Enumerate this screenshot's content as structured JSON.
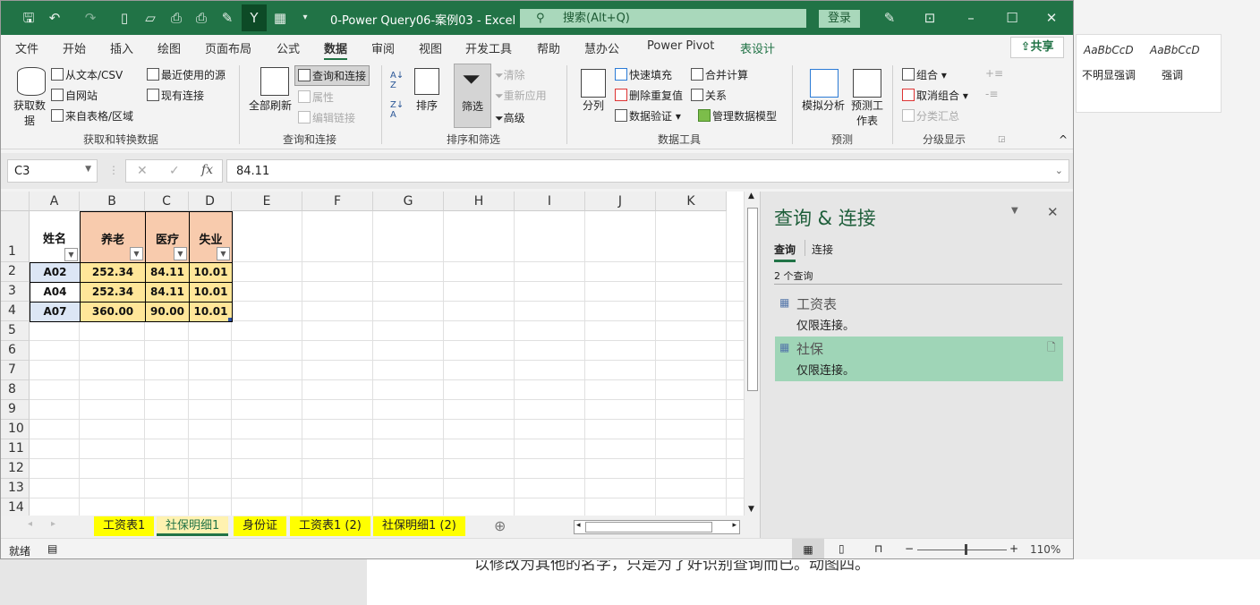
{
  "window": {
    "title": "0-Power Query06-案例03  -  Excel",
    "search_placeholder": "搜索(Alt+Q)",
    "login": "登录"
  },
  "menu_tabs": [
    "文件",
    "开始",
    "插入",
    "绘图",
    "页面布局",
    "公式",
    "数据",
    "审阅",
    "视图",
    "开发工具",
    "帮助",
    "慧办公",
    "Power Pivot",
    "表设计"
  ],
  "active_tab": "数据",
  "share": "共享",
  "ribbon": {
    "get_data": "获取数据",
    "from_text_csv": "从文本/CSV",
    "from_web": "自网站",
    "from_table": "来自表格/区域",
    "recent_sources": "最近使用的源",
    "existing_connections": "现有连接",
    "group_get": "获取和转换数据",
    "refresh_all": "全部刷新",
    "queries_connections": "查询和连接",
    "properties": "属性",
    "edit_links": "编辑链接",
    "group_queries": "查询和连接",
    "sort": "排序",
    "filter": "筛选",
    "clear": "清除",
    "reapply": "重新应用",
    "advanced": "高级",
    "group_sort": "排序和筛选",
    "text_to_columns": "分列",
    "flash_fill": "快速填充",
    "remove_duplicates": "删除重复值",
    "data_validation": "数据验证",
    "consolidate": "合并计算",
    "relationships": "关系",
    "manage_data_model": "管理数据模型",
    "group_tools": "数据工具",
    "what_if": "模拟分析",
    "forecast_sheet": "预测工作表",
    "group_forecast": "预测",
    "group": "组合",
    "ungroup": "取消组合",
    "subtotal": "分类汇总",
    "group_outline": "分级显示"
  },
  "background_word": {
    "style1_preview": "AaBbCcD",
    "style1": "不明显强调",
    "style2_preview": "AaBbCcD",
    "style2": "强调",
    "doc_text": "以修改为其他的名字，只是为了好识别查询而已。动图四。"
  },
  "formula_bar": {
    "name_box": "C3",
    "fx": "fx",
    "value": "84.11"
  },
  "columns": [
    "A",
    "B",
    "C",
    "D",
    "E",
    "F",
    "G",
    "H",
    "I",
    "J",
    "K"
  ],
  "rows": [
    "1",
    "2",
    "3",
    "4",
    "5",
    "6",
    "7",
    "8",
    "9",
    "10",
    "11",
    "12",
    "13",
    "14"
  ],
  "table": {
    "headers": [
      "姓名",
      "养老",
      "医疗",
      "失业"
    ],
    "data": [
      [
        "A02",
        "252.34",
        "84.11",
        "10.01"
      ],
      [
        "A04",
        "252.34",
        "84.11",
        "10.01"
      ],
      [
        "A07",
        "360.00",
        "90.00",
        "10.01"
      ]
    ]
  },
  "pane": {
    "title": "查询 & 连接",
    "tab_queries": "查询",
    "tab_connections": "连接",
    "count": "2 个查询",
    "queries": [
      {
        "name": "工资表",
        "status": "仅限连接。"
      },
      {
        "name": "社保",
        "status": "仅限连接。"
      }
    ]
  },
  "sheets": [
    "工资表1",
    "社保明细1",
    "身份证",
    "工资表1 (2)",
    "社保明细1 (2)"
  ],
  "active_sheet": "社保明细1",
  "status": {
    "ready": "就绪",
    "zoom": "110%",
    "zoom_fraction": 0.55
  },
  "colors": {
    "excel_green": "#217346",
    "header_fill": "#f8cbad",
    "data_fill": "#ffe699",
    "sheet_tab": "#ffff00",
    "selected_query": "#9fd5b7"
  }
}
